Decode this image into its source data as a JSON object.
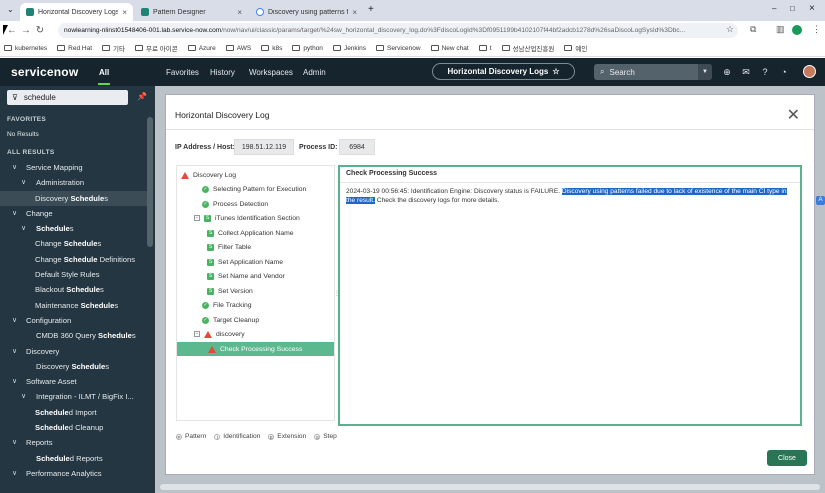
{
  "browser": {
    "tabs": [
      {
        "title": "Horizontal Discovery Logs | Se",
        "close": "×"
      },
      {
        "title": "Pattern Designer",
        "close": "×"
      },
      {
        "title": "Discovery using patterns faile",
        "close": "×"
      }
    ],
    "new_tab": "+",
    "window_controls": [
      "–",
      "□",
      "×"
    ],
    "address": {
      "host": "nowlearning-nlinst01548406-001.lab.service-now.com",
      "path": "/now/nav/ui/classic/params/target/%24sw_horizontal_discovery_log.do%3FdiscoLogId%3Df0951199b4102107f44bf2adcb1278d%26saDiscoLogSysId%3Dbc..."
    },
    "bookmarks": [
      "kubernetes",
      "Red Hat",
      "기타",
      "무료 아이콘",
      "Azure",
      "AWS",
      "k8s",
      "python",
      "Jenkins",
      "Servicenow",
      "New chat",
      "t",
      "성남산업진흥원",
      "예인"
    ]
  },
  "header": {
    "logo": "servicenow",
    "all_tab": "All",
    "nav": [
      "Favorites",
      "History",
      "Workspaces",
      "Admin"
    ],
    "context_pill": "Horizontal Discovery Logs",
    "star": "☆",
    "search_placeholder": "Search"
  },
  "sidebar": {
    "filter_value": "schedule",
    "favorites_heading": "FAVORITES",
    "no_results": "No Results",
    "all_results_heading": "ALL RESULTS",
    "items": [
      {
        "level": 0,
        "pre": "Service Mapping",
        "em": "",
        "post": "",
        "caret": "∨"
      },
      {
        "level": 1,
        "pre": "Administration",
        "em": "",
        "post": "",
        "caret": "∨"
      },
      {
        "level": 2,
        "pre": "Discovery ",
        "em": "Schedule",
        "post": "s",
        "caret": "",
        "selected": true
      },
      {
        "level": 0,
        "pre": "Change",
        "em": "",
        "post": "",
        "caret": "∨"
      },
      {
        "level": 1,
        "pre": "",
        "em": "Schedule",
        "post": "s",
        "caret": "∨"
      },
      {
        "level": 2,
        "pre": "Change ",
        "em": "Schedule",
        "post": "s",
        "caret": ""
      },
      {
        "level": 2,
        "pre": "Change ",
        "em": "Schedule",
        "post": " Definitions",
        "caret": ""
      },
      {
        "level": 2,
        "pre": "Default Style Rules",
        "em": "",
        "post": "",
        "caret": ""
      },
      {
        "level": 2,
        "pre": "Blackout ",
        "em": "Schedule",
        "post": "s",
        "caret": ""
      },
      {
        "level": 2,
        "pre": "Maintenance ",
        "em": "Schedule",
        "post": "s",
        "caret": ""
      },
      {
        "level": 0,
        "pre": "Configuration",
        "em": "",
        "post": "",
        "caret": "∨"
      },
      {
        "level": 1,
        "pre": "CMDB 360 Query ",
        "em": "Schedule",
        "post": "s",
        "caret": ""
      },
      {
        "level": 0,
        "pre": "Discovery",
        "em": "",
        "post": "",
        "caret": "∨"
      },
      {
        "level": 1,
        "pre": "Discovery ",
        "em": "Schedule",
        "post": "s",
        "caret": ""
      },
      {
        "level": 0,
        "pre": "Software Asset",
        "em": "",
        "post": "",
        "caret": "∨"
      },
      {
        "level": 1,
        "pre": "Integration - ILMT / BigFix I...",
        "em": "",
        "post": "",
        "caret": "∨"
      },
      {
        "level": 2,
        "pre": "",
        "em": "Schedule",
        "post": "d Import",
        "caret": ""
      },
      {
        "level": 2,
        "pre": "",
        "em": "Schedule",
        "post": "d Cleanup",
        "caret": ""
      },
      {
        "level": 0,
        "pre": "Reports",
        "em": "",
        "post": "",
        "caret": "∨"
      },
      {
        "level": 1,
        "pre": "",
        "em": "Schedule",
        "post": "d Reports",
        "caret": ""
      },
      {
        "level": 0,
        "pre": "Performance Analytics",
        "em": "",
        "post": "",
        "caret": "∨"
      }
    ]
  },
  "modal": {
    "title": "Horizontal Discovery Log",
    "ip_label": "IP Address / Host:",
    "ip_value": "198.51.12.119",
    "pid_label": "Process ID:",
    "pid_value": "6984",
    "tree": [
      {
        "label": "Discovery Log",
        "icon": "warn",
        "indent": 0
      },
      {
        "label": "Selecting Pattern for Execution",
        "icon": "ok",
        "indent": 1
      },
      {
        "label": "Process Detection",
        "icon": "ok",
        "indent": 1
      },
      {
        "label": "iTunes Identification Section",
        "icon": "sq",
        "indent": 1,
        "expander": "−"
      },
      {
        "label": "Collect Application Name",
        "icon": "sq",
        "indent": 2
      },
      {
        "label": "Filter Table",
        "icon": "sq",
        "indent": 2
      },
      {
        "label": "Set Application Name",
        "icon": "sq",
        "indent": 2
      },
      {
        "label": "Set Name and Vendor",
        "icon": "sq",
        "indent": 2
      },
      {
        "label": "Set Version",
        "icon": "sq",
        "indent": 2
      },
      {
        "label": "File Tracking",
        "icon": "ok",
        "indent": 1
      },
      {
        "label": "Target Cleanup",
        "icon": "ok",
        "indent": 1
      },
      {
        "label": "discovery",
        "icon": "warn",
        "indent": 1,
        "expander": "−"
      },
      {
        "label": "Check Processing Success",
        "icon": "warn",
        "indent": 2,
        "selected": true
      }
    ],
    "detail_title": "Check Processing Success",
    "detail_prefix": "2024-03-19 00:56:45: Identification Engine: Discovery status is FAILURE. ",
    "detail_highlight": "Discovery using patterns failed due to lack of existence of the main CI type in the result.",
    "detail_suffix": " Check the discovery logs for more details.",
    "legend": [
      {
        "key": "P",
        "label": "Pattern"
      },
      {
        "key": "I",
        "label": "Identification"
      },
      {
        "key": "E",
        "label": "Extension"
      },
      {
        "key": "S",
        "label": "Step"
      }
    ],
    "close_label": "Close",
    "close_x": "✕"
  }
}
